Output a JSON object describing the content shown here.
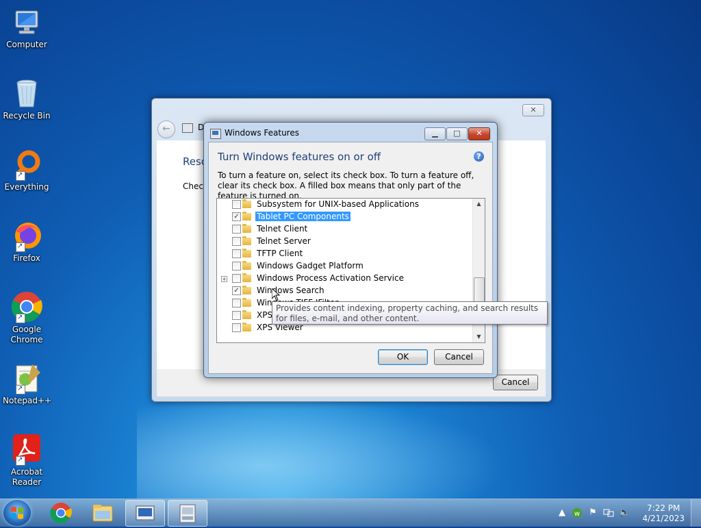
{
  "desktop": {
    "icons": [
      {
        "label": "Computer",
        "icon": "computer-icon"
      },
      {
        "label": "Recycle Bin",
        "icon": "recycle-bin-icon"
      },
      {
        "label": "Everything",
        "icon": "everything-icon"
      },
      {
        "label": "Firefox",
        "icon": "firefox-icon"
      },
      {
        "label": "Google Chrome",
        "icon": "chrome-icon"
      },
      {
        "label": "Notepad++",
        "icon": "notepadpp-icon"
      },
      {
        "label": "Acrobat Reader",
        "icon": "acrobat-icon"
      }
    ]
  },
  "outer_window": {
    "address_fragment": "D",
    "heading_fragment": "Reso",
    "text_fragment": "Check",
    "cancel_label": "Cancel",
    "close_glyph": "✕"
  },
  "dialog": {
    "title": "Windows Features",
    "heading": "Turn Windows features on or off",
    "help_glyph": "?",
    "description": "To turn a feature on, select its check box. To turn a feature off, clear its check box. A filled box means that only part of the feature is turned on.",
    "minimize_glyph": "▁",
    "maximize_glyph": "□",
    "close_glyph": "✕",
    "ok_label": "OK",
    "cancel_label": "Cancel",
    "features": [
      {
        "label": "Subsystem for UNIX-based Applications",
        "checked": false,
        "expandable": false,
        "selected": false
      },
      {
        "label": "Tablet PC Components",
        "checked": true,
        "expandable": false,
        "selected": true
      },
      {
        "label": "Telnet Client",
        "checked": false,
        "expandable": false,
        "selected": false
      },
      {
        "label": "Telnet Server",
        "checked": false,
        "expandable": false,
        "selected": false
      },
      {
        "label": "TFTP Client",
        "checked": false,
        "expandable": false,
        "selected": false
      },
      {
        "label": "Windows Gadget Platform",
        "checked": false,
        "expandable": false,
        "selected": false
      },
      {
        "label": "Windows Process Activation Service",
        "checked": false,
        "expandable": true,
        "selected": false
      },
      {
        "label": "Windows Search",
        "checked": true,
        "expandable": false,
        "selected": false
      },
      {
        "label": "Windows TIFF IFilter",
        "checked": false,
        "expandable": false,
        "selected": false
      },
      {
        "label": "XPS Services",
        "checked": false,
        "expandable": false,
        "selected": false
      },
      {
        "label": "XPS Viewer",
        "checked": false,
        "expandable": false,
        "selected": false
      }
    ],
    "tooltip": "Provides content indexing, property caching, and search results for files, e-mail, and other content."
  },
  "taskbar": {
    "clock_time": "7:22 PM",
    "clock_date": "4/21/2023",
    "items": [
      "chrome-icon",
      "explorer-icon",
      "control-panel-icon",
      "windows-features-icon"
    ]
  }
}
